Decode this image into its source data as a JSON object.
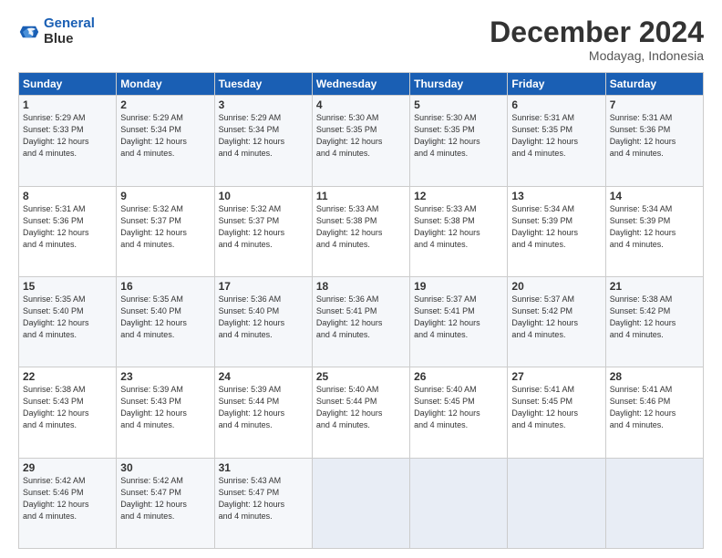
{
  "logo": {
    "line1": "General",
    "line2": "Blue"
  },
  "title": "December 2024",
  "location": "Modayag, Indonesia",
  "days_of_week": [
    "Sunday",
    "Monday",
    "Tuesday",
    "Wednesday",
    "Thursday",
    "Friday",
    "Saturday"
  ],
  "weeks": [
    [
      {
        "day": "1",
        "info": "Sunrise: 5:29 AM\nSunset: 5:33 PM\nDaylight: 12 hours\nand 4 minutes."
      },
      {
        "day": "2",
        "info": "Sunrise: 5:29 AM\nSunset: 5:34 PM\nDaylight: 12 hours\nand 4 minutes."
      },
      {
        "day": "3",
        "info": "Sunrise: 5:29 AM\nSunset: 5:34 PM\nDaylight: 12 hours\nand 4 minutes."
      },
      {
        "day": "4",
        "info": "Sunrise: 5:30 AM\nSunset: 5:35 PM\nDaylight: 12 hours\nand 4 minutes."
      },
      {
        "day": "5",
        "info": "Sunrise: 5:30 AM\nSunset: 5:35 PM\nDaylight: 12 hours\nand 4 minutes."
      },
      {
        "day": "6",
        "info": "Sunrise: 5:31 AM\nSunset: 5:35 PM\nDaylight: 12 hours\nand 4 minutes."
      },
      {
        "day": "7",
        "info": "Sunrise: 5:31 AM\nSunset: 5:36 PM\nDaylight: 12 hours\nand 4 minutes."
      }
    ],
    [
      {
        "day": "8",
        "info": "Sunrise: 5:31 AM\nSunset: 5:36 PM\nDaylight: 12 hours\nand 4 minutes."
      },
      {
        "day": "9",
        "info": "Sunrise: 5:32 AM\nSunset: 5:37 PM\nDaylight: 12 hours\nand 4 minutes."
      },
      {
        "day": "10",
        "info": "Sunrise: 5:32 AM\nSunset: 5:37 PM\nDaylight: 12 hours\nand 4 minutes."
      },
      {
        "day": "11",
        "info": "Sunrise: 5:33 AM\nSunset: 5:38 PM\nDaylight: 12 hours\nand 4 minutes."
      },
      {
        "day": "12",
        "info": "Sunrise: 5:33 AM\nSunset: 5:38 PM\nDaylight: 12 hours\nand 4 minutes."
      },
      {
        "day": "13",
        "info": "Sunrise: 5:34 AM\nSunset: 5:39 PM\nDaylight: 12 hours\nand 4 minutes."
      },
      {
        "day": "14",
        "info": "Sunrise: 5:34 AM\nSunset: 5:39 PM\nDaylight: 12 hours\nand 4 minutes."
      }
    ],
    [
      {
        "day": "15",
        "info": "Sunrise: 5:35 AM\nSunset: 5:40 PM\nDaylight: 12 hours\nand 4 minutes."
      },
      {
        "day": "16",
        "info": "Sunrise: 5:35 AM\nSunset: 5:40 PM\nDaylight: 12 hours\nand 4 minutes."
      },
      {
        "day": "17",
        "info": "Sunrise: 5:36 AM\nSunset: 5:40 PM\nDaylight: 12 hours\nand 4 minutes."
      },
      {
        "day": "18",
        "info": "Sunrise: 5:36 AM\nSunset: 5:41 PM\nDaylight: 12 hours\nand 4 minutes."
      },
      {
        "day": "19",
        "info": "Sunrise: 5:37 AM\nSunset: 5:41 PM\nDaylight: 12 hours\nand 4 minutes."
      },
      {
        "day": "20",
        "info": "Sunrise: 5:37 AM\nSunset: 5:42 PM\nDaylight: 12 hours\nand 4 minutes."
      },
      {
        "day": "21",
        "info": "Sunrise: 5:38 AM\nSunset: 5:42 PM\nDaylight: 12 hours\nand 4 minutes."
      }
    ],
    [
      {
        "day": "22",
        "info": "Sunrise: 5:38 AM\nSunset: 5:43 PM\nDaylight: 12 hours\nand 4 minutes."
      },
      {
        "day": "23",
        "info": "Sunrise: 5:39 AM\nSunset: 5:43 PM\nDaylight: 12 hours\nand 4 minutes."
      },
      {
        "day": "24",
        "info": "Sunrise: 5:39 AM\nSunset: 5:44 PM\nDaylight: 12 hours\nand 4 minutes."
      },
      {
        "day": "25",
        "info": "Sunrise: 5:40 AM\nSunset: 5:44 PM\nDaylight: 12 hours\nand 4 minutes."
      },
      {
        "day": "26",
        "info": "Sunrise: 5:40 AM\nSunset: 5:45 PM\nDaylight: 12 hours\nand 4 minutes."
      },
      {
        "day": "27",
        "info": "Sunrise: 5:41 AM\nSunset: 5:45 PM\nDaylight: 12 hours\nand 4 minutes."
      },
      {
        "day": "28",
        "info": "Sunrise: 5:41 AM\nSunset: 5:46 PM\nDaylight: 12 hours\nand 4 minutes."
      }
    ],
    [
      {
        "day": "29",
        "info": "Sunrise: 5:42 AM\nSunset: 5:46 PM\nDaylight: 12 hours\nand 4 minutes."
      },
      {
        "day": "30",
        "info": "Sunrise: 5:42 AM\nSunset: 5:47 PM\nDaylight: 12 hours\nand 4 minutes."
      },
      {
        "day": "31",
        "info": "Sunrise: 5:43 AM\nSunset: 5:47 PM\nDaylight: 12 hours\nand 4 minutes."
      },
      {
        "day": "",
        "info": ""
      },
      {
        "day": "",
        "info": ""
      },
      {
        "day": "",
        "info": ""
      },
      {
        "day": "",
        "info": ""
      }
    ]
  ]
}
